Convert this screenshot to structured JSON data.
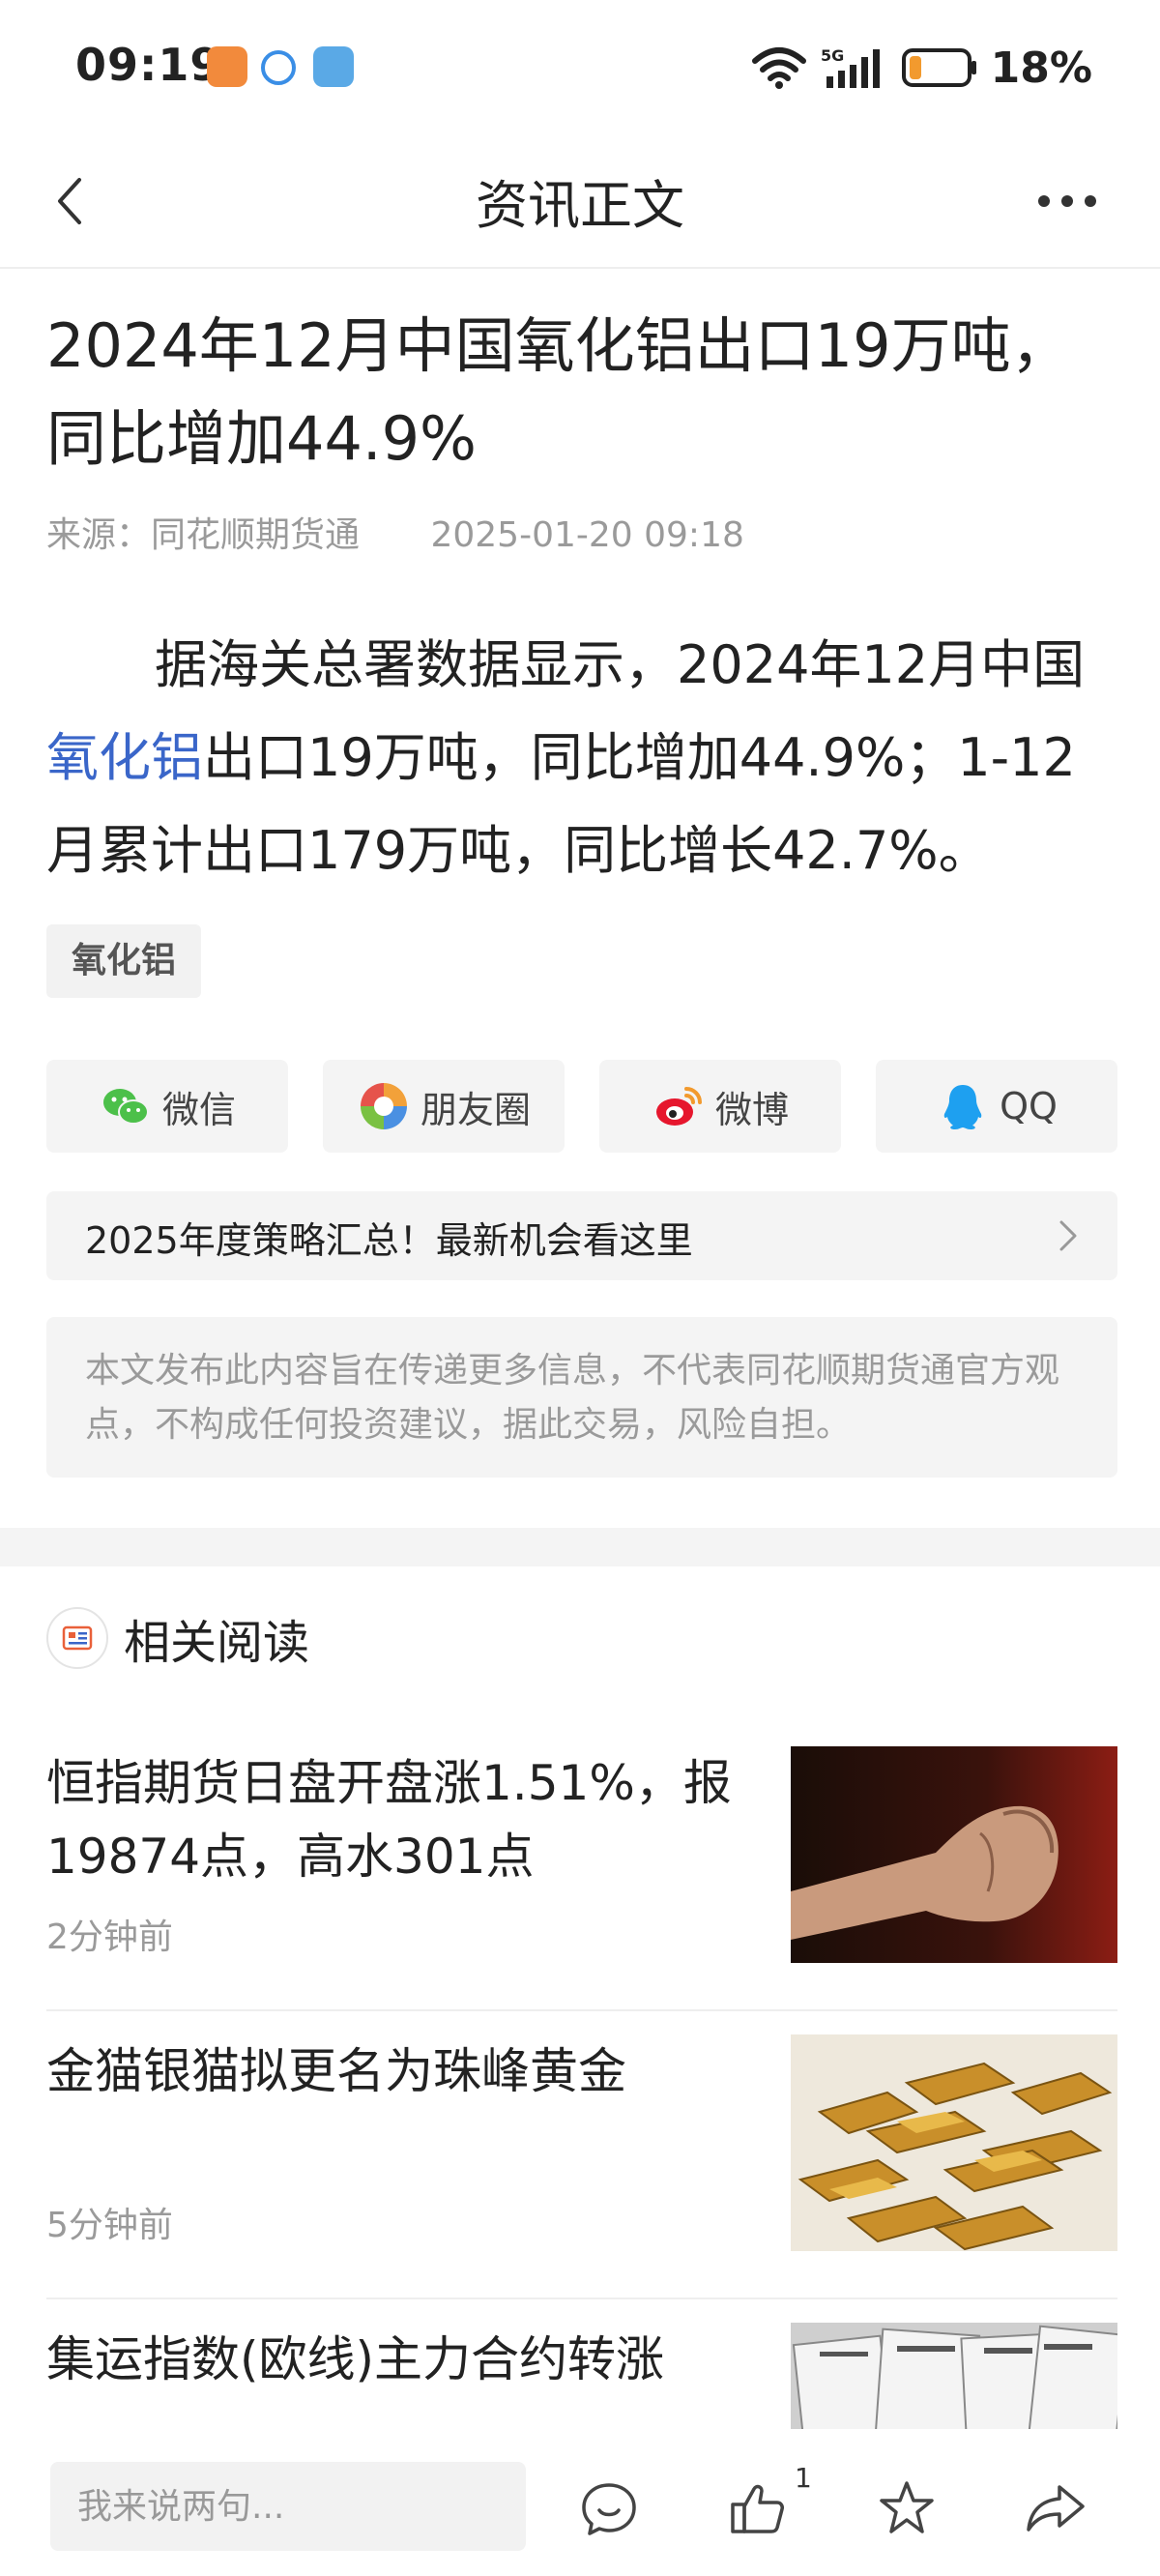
{
  "status_bar": {
    "time": "09:19",
    "battery": "18%",
    "network": "5G"
  },
  "nav": {
    "title": "资讯正文"
  },
  "article": {
    "title_line1": "2024年12月中国氧化铝出口19万吨，",
    "title_line2": "同比增加44.9%",
    "source": "来源：同花顺期货通",
    "date": "2025-01-20 09:18",
    "body_part1": "据海关总署数据显示，2024年12月中国",
    "body_link": "氧化铝",
    "body_part2": "出口19万吨，同比增加44.9%；1-12月累计出口179万吨，同比增长42.7%。",
    "tag": "氧化铝"
  },
  "share": {
    "wechat": "微信",
    "moments": "朋友圈",
    "weibo": "微博",
    "qq": "QQ"
  },
  "promo": {
    "text": "2025年度策略汇总！最新机会看这里"
  },
  "disclaimer": "本文发布此内容旨在传递更多信息，不代表同花顺期货通官方观点，不构成任何投资建议，据此交易，风险自担。",
  "related": {
    "title": "相关阅读",
    "items": [
      {
        "headline": "恒指期货日盘开盘涨1.51%，报19874点，高水301点",
        "ago": "2分钟前",
        "thumb": "fist-photo"
      },
      {
        "headline": "金猫银猫拟更名为珠峰黄金",
        "ago": "5分钟前",
        "thumb": "gold-bars-photo"
      },
      {
        "headline": "集运指数(欧线)主力合约转涨",
        "ago": "",
        "thumb": "newspapers-photo"
      }
    ]
  },
  "bottom_bar": {
    "comment_placeholder": "我来说两句...",
    "like_count": "1"
  },
  "colors": {
    "link": "#3a66c9",
    "muted": "#9a9a9a",
    "panel": "#f4f4f4"
  }
}
